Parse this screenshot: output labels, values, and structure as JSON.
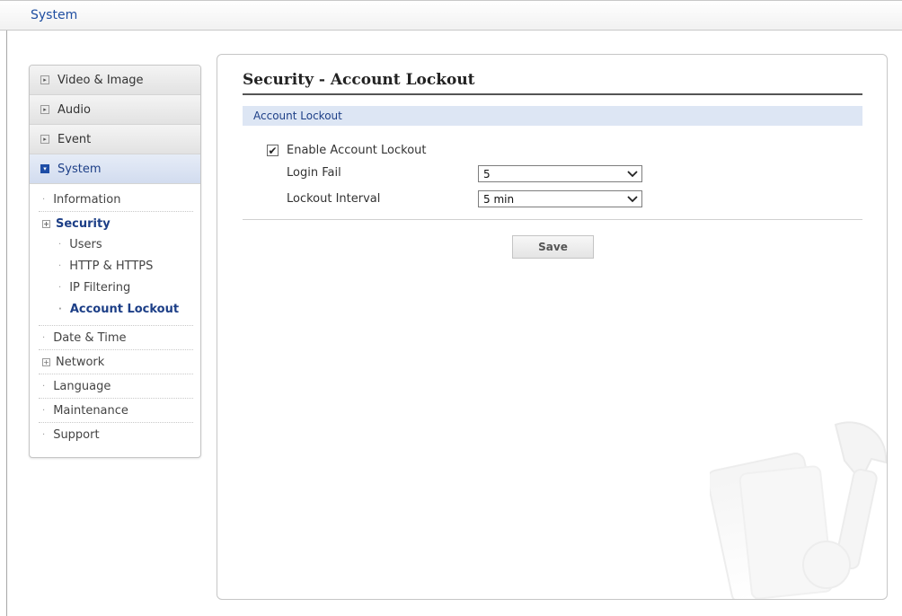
{
  "header": {
    "title": "System"
  },
  "sidebar": {
    "categories": [
      {
        "label": "Video & Image"
      },
      {
        "label": "Audio"
      },
      {
        "label": "Event"
      },
      {
        "label": "System"
      }
    ],
    "system_items": {
      "information": "Information",
      "security": "Security",
      "security_children": [
        "Users",
        "HTTP & HTTPS",
        "IP Filtering",
        "Account Lockout"
      ],
      "date_time": "Date & Time",
      "network": "Network",
      "language": "Language",
      "maintenance": "Maintenance",
      "support": "Support"
    }
  },
  "main": {
    "title": "Security - Account Lockout",
    "section": "Account Lockout",
    "enable_label": "Enable Account Lockout",
    "enable_checked": true,
    "login_fail_label": "Login Fail",
    "login_fail_value": "5",
    "lockout_interval_label": "Lockout Interval",
    "lockout_interval_value": "5 min",
    "save_label": "Save"
  },
  "icons": {
    "collapsed": "collapsed-box-icon",
    "expanded": "expanded-checkbox-icon",
    "dropdown": "chevron-down-icon",
    "tree_expand": "plus-box-icon",
    "watermark": "tools-watermark-icon"
  },
  "colors": {
    "accent": "#1d3f87",
    "section_bg": "#dde6f4",
    "active_category_bg": "#d2dcef"
  }
}
